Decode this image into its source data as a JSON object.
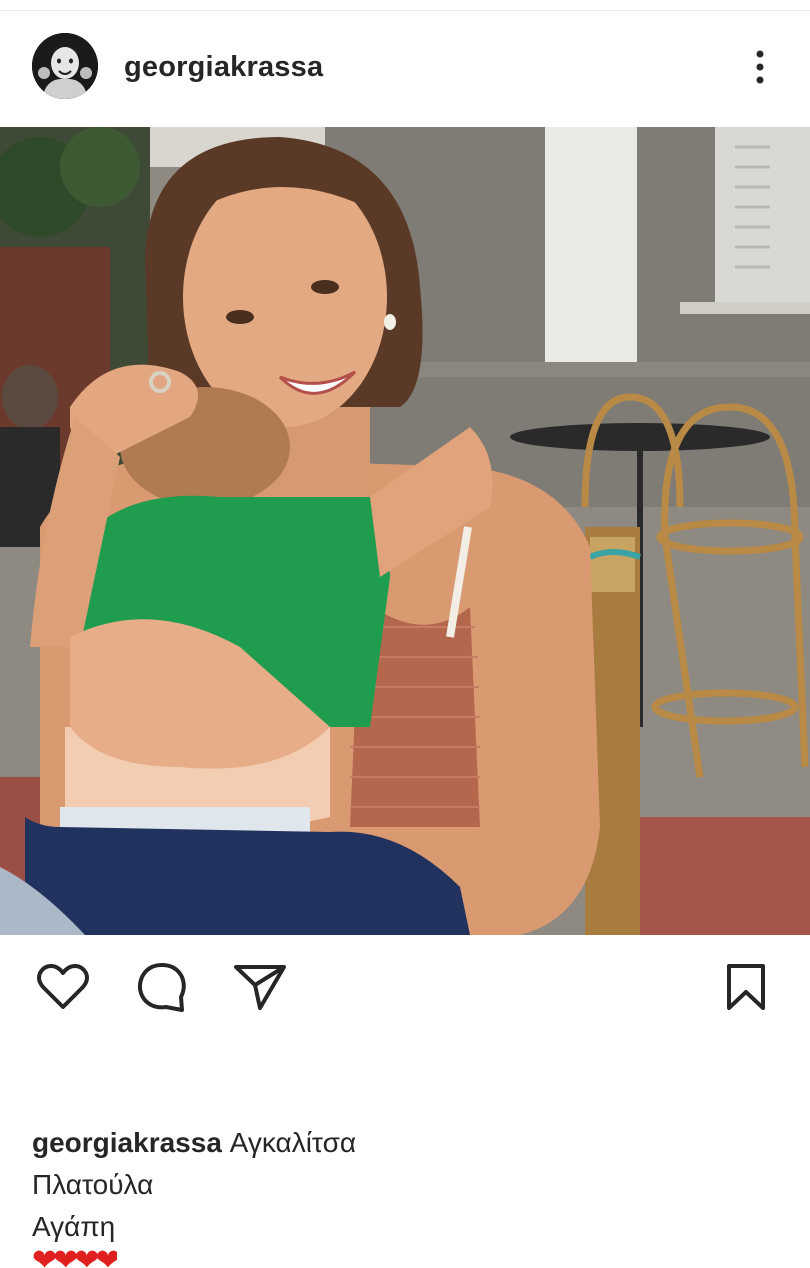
{
  "post": {
    "username": "georgiakrassa",
    "more_icon": "more-vertical-icon"
  },
  "photo": {
    "description_icon": "photo"
  },
  "actions": {
    "like_icon": "heart-outline-icon",
    "comment_icon": "comment-bubble-icon",
    "share_icon": "paper-plane-icon",
    "save_icon": "bookmark-outline-icon"
  },
  "caption": {
    "username": "georgiakrassa",
    "line1_text": "Αγκαλίτσα",
    "line2": "Πλατούλα",
    "line3": "Αγάπη",
    "hearts": "❤❤❤❤"
  },
  "colors": {
    "text": "#262626",
    "heart": "#e0201f",
    "background": "#ffffff"
  }
}
